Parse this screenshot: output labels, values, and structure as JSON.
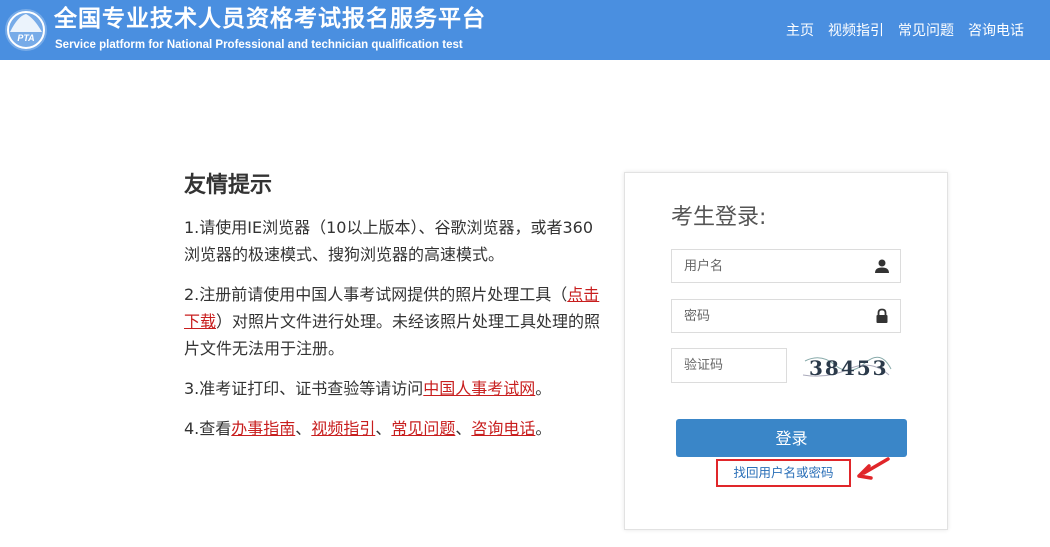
{
  "header": {
    "title": "全国专业技术人员资格考试报名服务平台",
    "subtitle": "Service platform for National Professional and technician qualification test",
    "logo_text": "PTA",
    "nav": [
      "主页",
      "视频指引",
      "常见问题",
      "咨询电话"
    ],
    "bg_color": "#4a8fe0"
  },
  "tips": {
    "heading": "友情提示",
    "item1": "1.请使用IE浏览器（10以上版本）、谷歌浏览器，或者360浏览器的极速模式、搜狗浏览器的高速模式。",
    "item2_pre": "2.注册前请使用中国人事考试网提供的照片处理工具（",
    "item2_link": "点击下载",
    "item2_post": "）对照片文件进行处理。未经该照片处理工具处理的照片文件无法用于注册。",
    "item3_pre": "3.准考证打印、证书查验等请访问",
    "item3_link": "中国人事考试网",
    "item3_post": "。",
    "item4_pre": "4.查看",
    "item4_links": [
      "办事指南",
      "视频指引",
      "常见问题",
      "咨询电话"
    ],
    "item4_sep": "、",
    "item4_post": "。",
    "link_color": "#c81e1e"
  },
  "login": {
    "title": "考生登录:",
    "username_placeholder": "用户名",
    "password_placeholder": "密码",
    "captcha_placeholder": "验证码",
    "captcha_code": "38453",
    "submit_label": "登录",
    "recover_label": "找回用户名或密码",
    "button_color": "#3a86c8",
    "highlight_color": "#e0262a"
  }
}
